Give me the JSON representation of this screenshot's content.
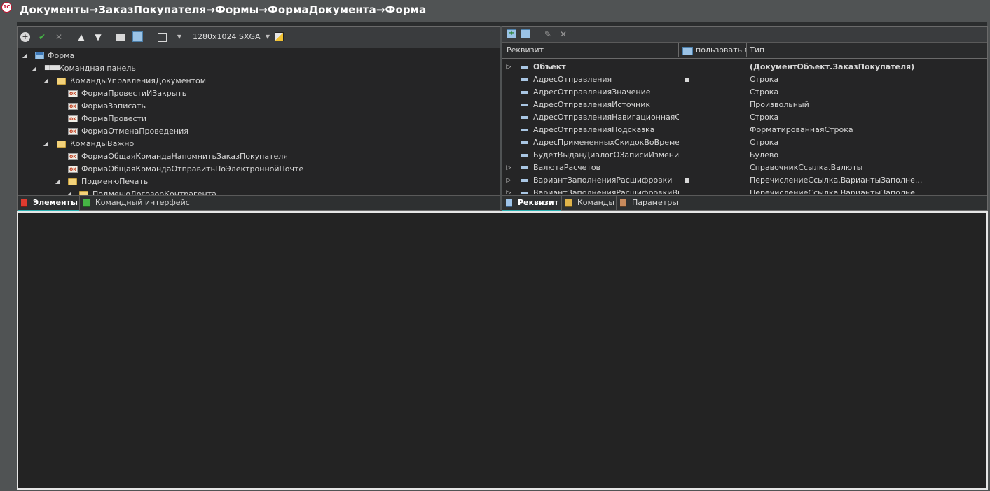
{
  "title": "Документы→ЗаказПокупателя→Формы→ФормаДокумента→Форма",
  "app_logo": "1С",
  "left_toolbar": {
    "resolution": "1280x1024 SXGA"
  },
  "tree": [
    {
      "label": "Форма"
    },
    {
      "label": "Командная панель"
    },
    {
      "label": "КомандыУправленияДокументом"
    },
    {
      "label": "ФормаПровестиИЗакрыть"
    },
    {
      "label": "ФормаЗаписать"
    },
    {
      "label": "ФормаПровести"
    },
    {
      "label": "ФормаОтменаПроведения"
    },
    {
      "label": "КомандыВажно"
    },
    {
      "label": "ФормаОбщаяКомандаНапомнитьЗаказПокупателя"
    },
    {
      "label": "ФормаОбщаяКомандаОтправитьПоЭлектроннойПочте"
    },
    {
      "label": "ПодменюПечать"
    },
    {
      "label": "ПодменюДоговорКонтрагента"
    }
  ],
  "left_tabs": {
    "elements": "Элементы",
    "command_interface": "Командный интерфейс"
  },
  "attr_grid": {
    "columns": {
      "attribute": "Реквизит",
      "use_always": "пользовать вс",
      "type": "Тип"
    },
    "rows": [
      {
        "name": "Объект",
        "type": "(ДокументОбъект.ЗаказПокупателя)"
      },
      {
        "name": "АдресОтправления",
        "type": "Строка"
      },
      {
        "name": "АдресОтправленияЗначение",
        "type": "Строка"
      },
      {
        "name": "АдресОтправленияИсточник",
        "type": "Произвольный"
      },
      {
        "name": "АдресОтправленияНавигационнаяСс",
        "type": "Строка"
      },
      {
        "name": "АдресОтправленияПодсказка",
        "type": "ФорматированнаяСтрока"
      },
      {
        "name": "АдресПримененныхСкидокВоВремен",
        "type": "Строка"
      },
      {
        "name": "БудетВыданДиалогОЗаписиИзмени",
        "type": "Булево"
      },
      {
        "name": "ВалютаРасчетов",
        "type": "СправочникСсылка.Валюты"
      },
      {
        "name": "ВариантЗаполненияРасшифровки",
        "type": "ПеречислениеСсылка.ВариантыЗаполне..."
      },
      {
        "name": "ВариантЗаполненияРасшифровкиВр",
        "type": "ПеречислениеСсылка.ВариантыЗаполне..."
      }
    ]
  },
  "right_tabs": {
    "attributes": "Реквизит",
    "commands": "Команды",
    "parameters": "Параметры"
  }
}
